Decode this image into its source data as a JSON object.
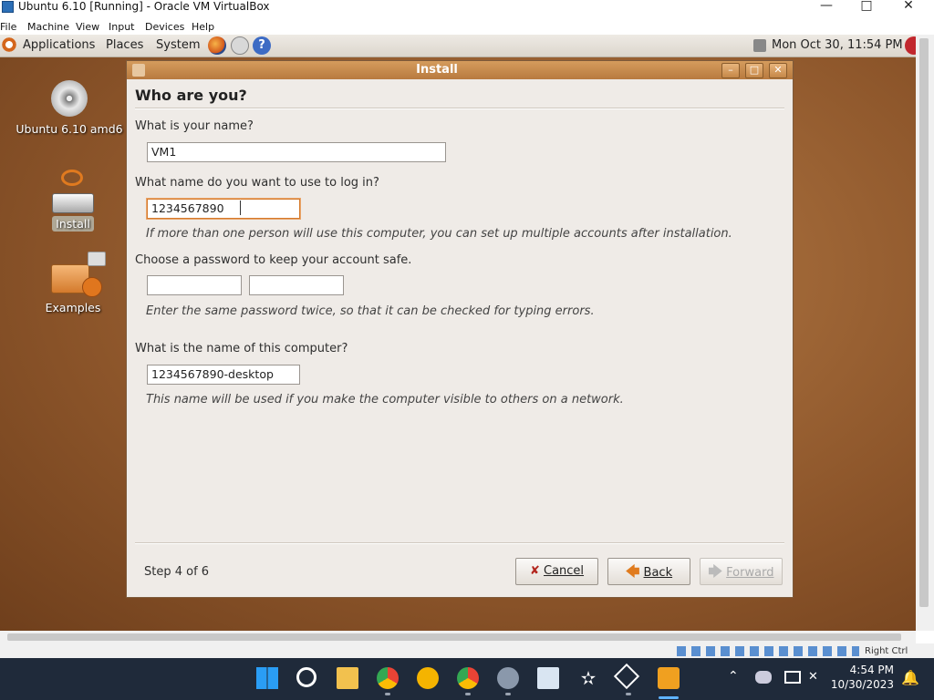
{
  "host": {
    "title": "Ubuntu 6.10 [Running] - Oracle VM VirtualBox",
    "menu": [
      "File",
      "Machine",
      "View",
      "Input",
      "Devices",
      "Help"
    ],
    "status_right": "Right Ctrl"
  },
  "guest_panel": {
    "menus": [
      "Applications",
      "Places",
      "System"
    ],
    "clock": "Mon Oct 30, 11:54 PM"
  },
  "desktop": {
    "icons": [
      {
        "label": "Ubuntu 6.10 amd6"
      },
      {
        "label": "Install"
      },
      {
        "label": "Examples"
      }
    ]
  },
  "dialog": {
    "title": "Install",
    "heading": "Who are you?",
    "name_label": "What is your name?",
    "name_value": "VM1",
    "login_label": "What name do you want to use to log in?",
    "login_value": "1234567890",
    "login_hint": "If more than one person will use this computer, you can set up multiple accounts after installation.",
    "password_label": "Choose a password to keep your account safe.",
    "password_hint": "Enter the same password twice, so that it can be checked for typing errors.",
    "computer_label": "What is the name of this computer?",
    "computer_value": "1234567890-desktop",
    "computer_hint": "This name will be used if you make the computer visible to others on a network.",
    "step": "Step 4 of 6",
    "cancel": "Cancel",
    "back": "Back",
    "forward": "Forward"
  },
  "taskbar": {
    "time": "4:54 PM",
    "date": "10/30/2023"
  },
  "colors": {
    "desktop": "#8c552a",
    "titlebar": "#c4894c",
    "focus_border": "#d57a2c",
    "taskbar": "#1f2a3a"
  }
}
